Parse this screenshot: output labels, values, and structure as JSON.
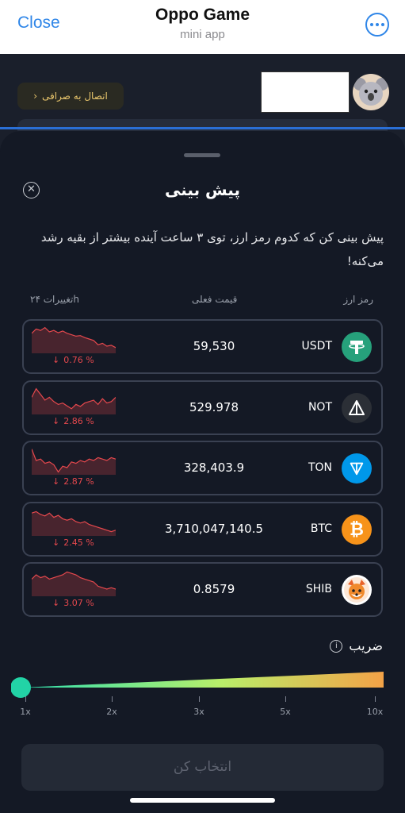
{
  "topbar": {
    "close_label": "Close",
    "title": "Oppo Game",
    "subtitle": "mini app",
    "more_icon": "more-icon"
  },
  "app": {
    "connect_label": "اتصال به صرافی",
    "connect_icon": "chevron-left-icon"
  },
  "sheet": {
    "title": "پیش بینی",
    "description": "پیش بینی کن که کدوم رمز ارز، توی ۳ ساعت آینده بیشتر از بقیه رشد می‌کنه!",
    "headers": {
      "coin": "رمز ارز",
      "price": "قیمت فعلی",
      "change": "تغییرات ۲۴h"
    },
    "coins": [
      {
        "symbol": "USDT",
        "price": "59,530",
        "change": "0.76 %",
        "icon": "tether-icon",
        "color": "#26a17b",
        "trend": [
          0.7,
          0.85,
          0.8,
          0.9,
          0.75,
          0.8,
          0.72,
          0.78,
          0.7,
          0.65,
          0.6,
          0.62,
          0.55,
          0.5,
          0.45,
          0.3,
          0.35,
          0.25,
          0.28,
          0.2
        ]
      },
      {
        "symbol": "NOT",
        "price": "529.978",
        "change": "2.86 %",
        "icon": "notcoin-icon",
        "color": "#2b2f36",
        "trend": [
          0.6,
          0.9,
          0.7,
          0.5,
          0.6,
          0.45,
          0.35,
          0.4,
          0.3,
          0.2,
          0.35,
          0.28,
          0.4,
          0.45,
          0.5,
          0.35,
          0.55,
          0.4,
          0.45,
          0.6
        ]
      },
      {
        "symbol": "TON",
        "price": "328,403.9",
        "change": "2.87 %",
        "icon": "ton-icon",
        "color": "#0098ea",
        "trend": [
          0.9,
          0.5,
          0.55,
          0.4,
          0.45,
          0.35,
          0.1,
          0.3,
          0.25,
          0.45,
          0.4,
          0.5,
          0.45,
          0.55,
          0.5,
          0.6,
          0.55,
          0.5,
          0.6,
          0.55
        ]
      },
      {
        "symbol": "BTC",
        "price": "3,710,047,140.5",
        "change": "2.45 %",
        "icon": "bitcoin-icon",
        "color": "#f7931a",
        "trend": [
          0.8,
          0.85,
          0.75,
          0.7,
          0.8,
          0.65,
          0.72,
          0.6,
          0.55,
          0.6,
          0.5,
          0.45,
          0.5,
          0.4,
          0.35,
          0.3,
          0.25,
          0.2,
          0.15,
          0.2
        ]
      },
      {
        "symbol": "SHIB",
        "price": "0.8579",
        "change": "3.07 %",
        "icon": "shiba-icon",
        "color": "#ffffff",
        "trend": [
          0.6,
          0.75,
          0.65,
          0.7,
          0.6,
          0.65,
          0.7,
          0.75,
          0.85,
          0.8,
          0.75,
          0.65,
          0.6,
          0.55,
          0.5,
          0.35,
          0.3,
          0.25,
          0.3,
          0.25
        ]
      }
    ],
    "multiplier": {
      "label": "ضریب",
      "ticks": [
        "1x",
        "2x",
        "3x",
        "5x",
        "10x"
      ],
      "value": "1x"
    },
    "choose_label": "انتخاب کن",
    "colors": {
      "down": "#e5484d",
      "slider_start": "#22d3a6",
      "slider_end": "#f0a44b"
    }
  }
}
